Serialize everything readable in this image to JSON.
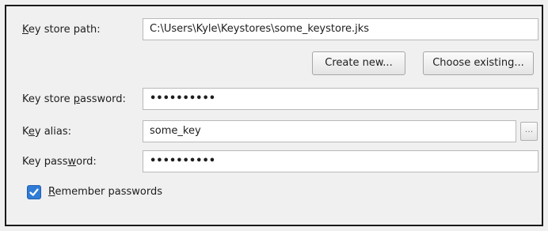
{
  "keystore_path": {
    "label_pre": "",
    "label_mnemonic": "K",
    "label_post": "ey store path:",
    "value": "C:\\Users\\Kyle\\Keystores\\some_keystore.jks"
  },
  "buttons": {
    "create_new": "Create new...",
    "choose_existing": "Choose existing..."
  },
  "keystore_password": {
    "label_pre": "Key store ",
    "label_mnemonic": "p",
    "label_post": "assword:",
    "value": "••••••••••"
  },
  "key_alias": {
    "label_pre": "K",
    "label_mnemonic": "e",
    "label_post": "y alias:",
    "value": "some_key",
    "browse_label": "..."
  },
  "key_password": {
    "label_pre": "Key pass",
    "label_mnemonic": "w",
    "label_post": "ord:",
    "value": "••••••••••"
  },
  "remember": {
    "checked": true,
    "label_mnemonic": "R",
    "label_post": "emember passwords"
  },
  "colors": {
    "checkbox_fill": "#2f7cd6",
    "background": "#f0f0f0"
  }
}
